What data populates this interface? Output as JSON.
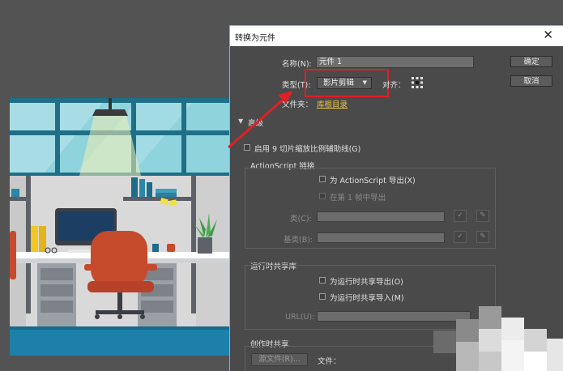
{
  "dialog": {
    "title": "转换为元件",
    "close_glyph": "✕",
    "name_label": "名称(N):",
    "name_value": "元件 1",
    "type_label": "类型(T):",
    "type_value": "影片剪辑",
    "align_label": "对齐：",
    "folder_label": "文件夹：",
    "folder_link": "库根目录",
    "ok_label": "确定",
    "cancel_label": "取消",
    "advanced_label": "高级",
    "nine_slice_label": "启用 9 切片缩放比例辅助线(G)",
    "actionscript": {
      "group_label": "ActionScript 链接",
      "export_as": "为 ActionScript 导出(X)",
      "export_first_frame": "在第 1 帧中导出",
      "class_label": "类(C):",
      "base_class_label": "基类(B):"
    },
    "runtime_shared": {
      "group_label": "运行时共享库",
      "export_label": "为运行时共享导出(O)",
      "import_label": "为运行时共享导入(M)",
      "url_label": "URL(U):"
    },
    "authoring": {
      "group_label": "创作时共享",
      "source_file_button": "源文件(R)...",
      "file_label": "文件："
    }
  },
  "colors": {
    "highlight": "#e01f26",
    "dialog_accent": "#e8a23a",
    "link": "#e8c24a"
  }
}
